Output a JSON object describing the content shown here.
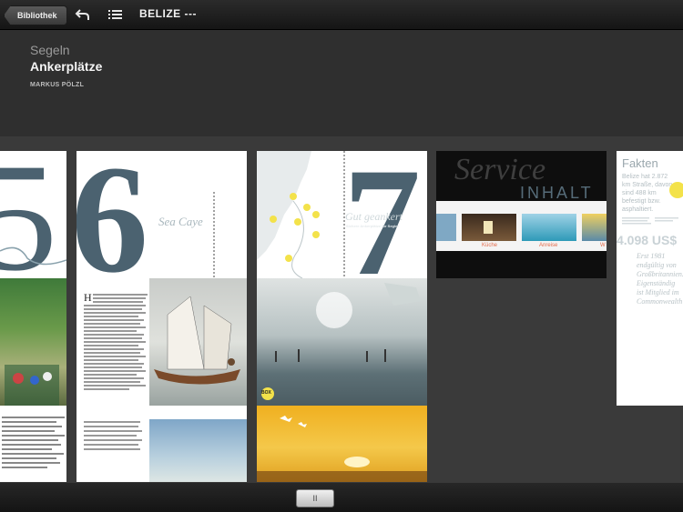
{
  "toolbar": {
    "back_label": "Bibliothek",
    "doc_title": "BELIZE ---",
    "icons": [
      "undo-icon",
      "list-icon"
    ]
  },
  "header": {
    "section": "Segeln",
    "title": "Ankerplätze",
    "author": "MARKUS PÖLZL"
  },
  "pages": {
    "p56_overlay": "Sea Caye",
    "p57_overlay": "Gut geankert",
    "p57_sub": "Sichere Ankerplätze für Segler",
    "service_word": "Service",
    "inhalt_word": "INHALT",
    "service_items": [
      "Küche",
      "Anreise",
      "W"
    ],
    "facts_title": "Fakten",
    "facts_text": "Belize hat 2.872 km Straße, davon sind 488 km befestigt bzw. asphaltiert.",
    "facts_number": "4.098 US$",
    "facts_bottom": "Erst 1981 endgültig von Großbritannien. Eigenständig ist Mitglied im Commonwealth",
    "badge": "BOX"
  },
  "scrubber_label": "II",
  "colors": {
    "accent_yellow": "#f3e24a",
    "slate_blue": "#4b6270",
    "toolbar_dark": "#1c1c1c"
  }
}
